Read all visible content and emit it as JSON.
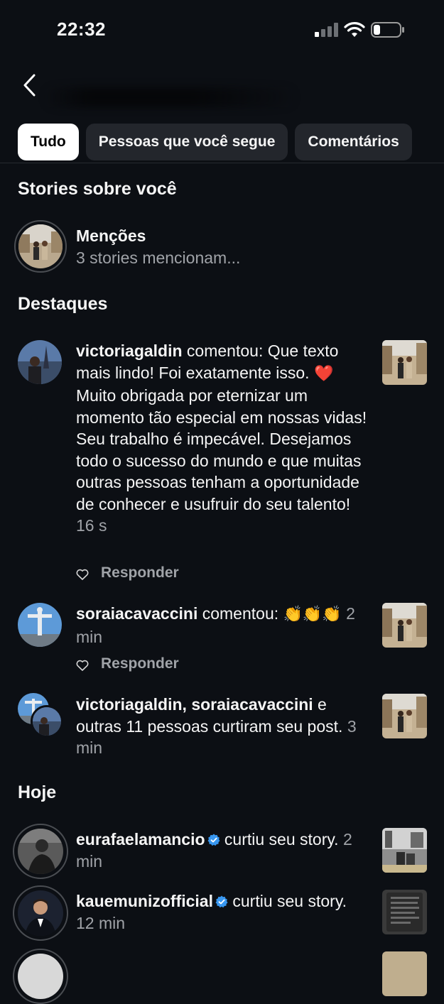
{
  "status": {
    "time": "22:32"
  },
  "tabs": [
    "Tudo",
    "Pessoas que você segue",
    "Comentários"
  ],
  "sections": {
    "stories": "Stories sobre você",
    "highlights": "Destaques",
    "today": "Hoje"
  },
  "mentions": {
    "title": "Menções",
    "subtitle": "3 stories mencionam..."
  },
  "notifications": [
    {
      "user": "victoriagaldin",
      "verb": " comentou: ",
      "text_a": "Que texto mais lindo! Foi exatamente isso. ",
      "heart": "❤️",
      "text_b": " Muito obrigada por eternizar um momento tão especial em nossas vidas! Seu trabalho é impecável. Desejamos todo o sucesso do mundo e que muitas outras pessoas tenham a oportunidade de conhecer e usufruir do seu talento!",
      "time": "16 s",
      "reply": "Responder"
    },
    {
      "user": "soraiacavaccini",
      "verb": " comentou: ",
      "emojis": "👏👏👏",
      "time": "2 min",
      "reply": "Responder"
    },
    {
      "users": "victoriagaldin, soraiacavaccini",
      "connector": " e ",
      "rest": "outras 11 pessoas curtiram seu post.",
      "time": "3 min"
    }
  ],
  "today": [
    {
      "user": "eurafaelamancio",
      "action": " curtiu seu story.",
      "time": "2 min"
    },
    {
      "user": "kauemunizofficial",
      "action": " curtiu seu story.",
      "time": "12 min"
    }
  ],
  "colors": {
    "background": "#0c0f14",
    "muted": "#a0a3a8",
    "verified": "#3897f0",
    "tab_bg": "#23262c"
  }
}
